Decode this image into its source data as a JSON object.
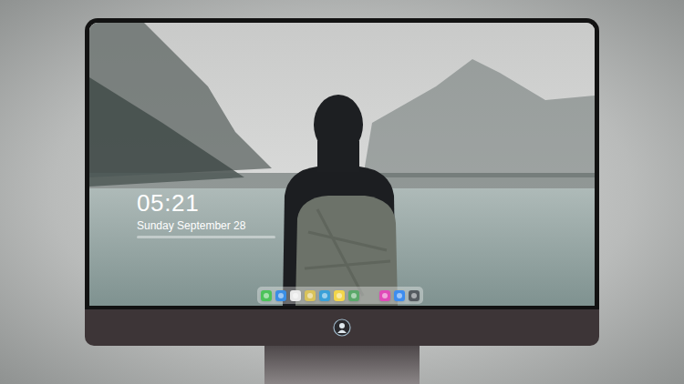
{
  "clock": {
    "time": "05:21",
    "date": "Sunday September 28"
  },
  "dock": {
    "items": [
      {
        "name": "messages",
        "color": "#4cc35a"
      },
      {
        "name": "finder",
        "color": "#3a8ee6"
      },
      {
        "name": "safari",
        "color": "#e9e9e9"
      },
      {
        "name": "preview",
        "color": "#d9c35a"
      },
      {
        "name": "videos",
        "color": "#3aa0d8"
      },
      {
        "name": "notes",
        "color": "#f3d54a"
      },
      {
        "name": "photos",
        "color": "#5aa86a"
      },
      {
        "name": "music",
        "color": "#e04ab8"
      },
      {
        "name": "app-store",
        "color": "#3d8df0"
      },
      {
        "name": "utilities",
        "color": "#555b60"
      }
    ]
  }
}
